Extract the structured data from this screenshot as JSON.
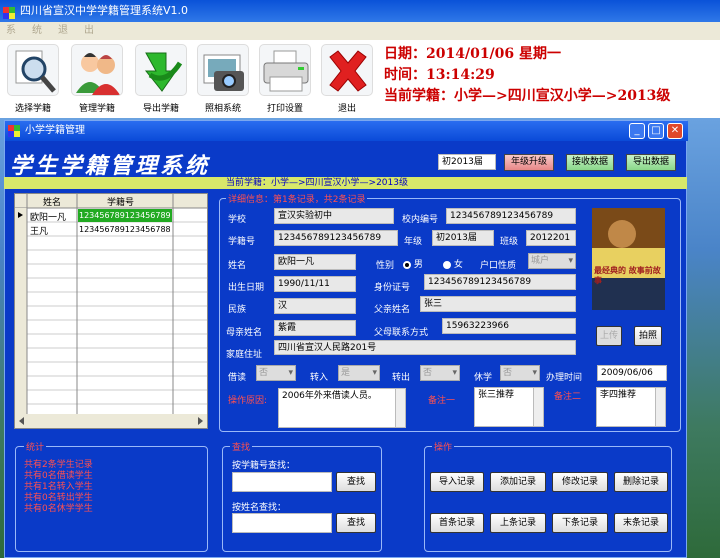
{
  "app": {
    "title": "四川省宣汉中学学籍管理系统V1.0",
    "menu": [
      "系",
      "统",
      "退",
      "出"
    ]
  },
  "toolbar": [
    {
      "label": "选择学籍",
      "icon": "magnifier-icon"
    },
    {
      "label": "管理学籍",
      "icon": "users-icon"
    },
    {
      "label": "导出学籍",
      "icon": "green-arrow-icon"
    },
    {
      "label": "照相系统",
      "icon": "camera-icon"
    },
    {
      "label": "打印设置",
      "icon": "printer-icon"
    },
    {
      "label": "退出",
      "icon": "red-x-icon"
    }
  ],
  "info": {
    "date": "日期：2014/01/06   星期一",
    "time": "时间：13:14:29",
    "current": "当前学籍：小学—>四川宣汉小学—>2013级"
  },
  "child": {
    "title": "小学学籍管理",
    "banner": "学生学籍管理系统",
    "grade_value": "初2013届",
    "upgrade": "年级升级",
    "receive": "接收数据",
    "export": "导出数据",
    "path": "当前学籍：小学—>四川宣汉小学—>2013级"
  },
  "grid": {
    "headers": [
      "姓名",
      "学籍号"
    ],
    "rows": [
      {
        "name": "欧阳一凡",
        "id": "123456789123456789"
      },
      {
        "name": "王凡",
        "id": "123456789123456788"
      }
    ]
  },
  "detail": {
    "legend": "详细信息：第1条记录，共2条记录",
    "school_l": "学校",
    "school": "宣汉实验初中",
    "inner_l": "校内编号",
    "inner": "123456789123456789",
    "sid_l": "学籍号",
    "sid": "123456789123456789",
    "grade_l": "年级",
    "grade": "初2013届",
    "class_l": "班级",
    "class": "2012201",
    "name_l": "姓名",
    "name": "欧阳一凡",
    "sex_l": "性别",
    "male": "男",
    "female": "女",
    "hukou_l": "户口性质",
    "hukou": "城户",
    "birth_l": "出生日期",
    "birth": "1990/11/11",
    "idcard_l": "身份证号",
    "idcard": "123456789123456789",
    "nation_l": "民族",
    "nation": "汉",
    "father_l": "父亲姓名",
    "father": "张三",
    "mother_l": "母亲姓名",
    "mother": "紫霞",
    "phone_l": "父母联系方式",
    "phone": "15963223966",
    "addr_l": "家庭住址",
    "addr": "四川省宣汉人民路201号",
    "upload": "上传",
    "photo": "拍照",
    "photo_text": "最经典的 故事前故事",
    "borrow_l": "借读",
    "borrow": "否",
    "in_l": "转入",
    "in": "是",
    "out_l": "转出",
    "out": "否",
    "rest_l": "休学",
    "rest": "否",
    "handle_l": "办理时间",
    "handle": "2009/06/06",
    "reason_l": "操作原因:",
    "reason": "2006年外来借读人员。",
    "note1_l": "备注一",
    "note1": "张三推荐",
    "note2_l": "备注二",
    "note2": "李四推荐"
  },
  "stats": {
    "legend": "统计",
    "lines": [
      "共有2条学生记录",
      "共有0名借读学生",
      "共有1名转入学生",
      "共有0名转出学生",
      "共有0名休学学生"
    ]
  },
  "search": {
    "legend": "查找",
    "by_id": "按学籍号查找：",
    "by_name": "按姓名查找：",
    "btn": "查找"
  },
  "ops": {
    "legend": "操作",
    "buttons": [
      "导入记录",
      "添加记录",
      "修改记录",
      "删除记录",
      "首条记录",
      "上条记录",
      "下条记录",
      "末条记录"
    ]
  },
  "colors": {
    "window_blue": "#0a3ac8",
    "title_blue": "#0a52d8",
    "alert_red": "#cc0000"
  }
}
